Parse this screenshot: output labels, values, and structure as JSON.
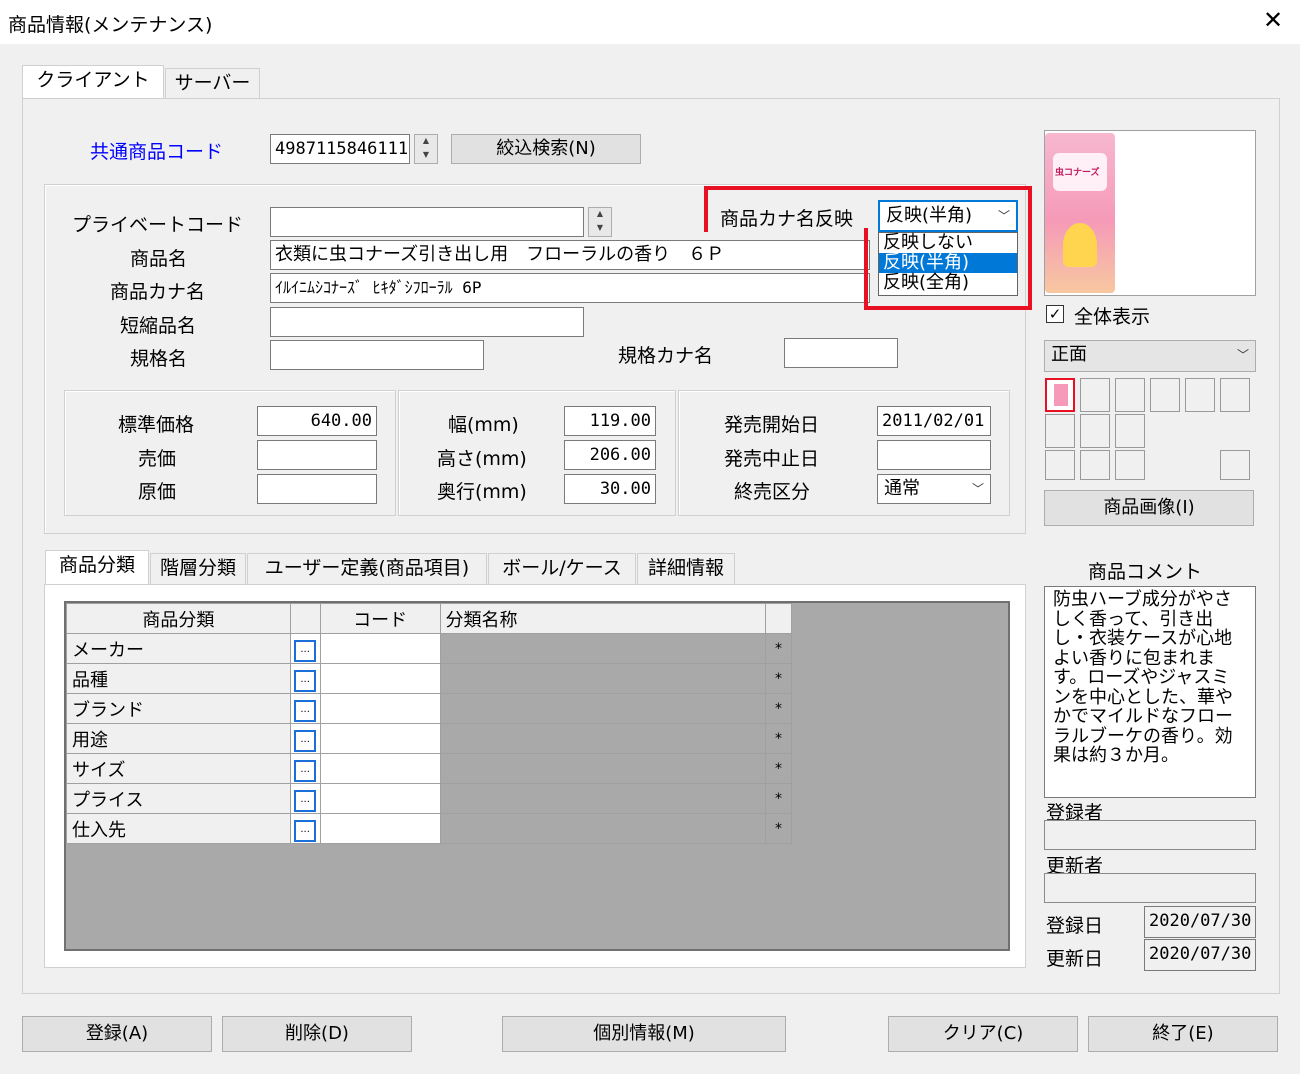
{
  "window": {
    "title": "商品情報(メンテナンス)",
    "close_glyph": "✕"
  },
  "tabs": [
    {
      "label": "クライアント"
    },
    {
      "label": "サーバー"
    }
  ],
  "common_code": {
    "label": "共通商品コード",
    "value": "4987115846111",
    "search_button": "絞込検索(N)"
  },
  "fields": {
    "private_code": {
      "label": "プライベートコード",
      "value": ""
    },
    "product_name": {
      "label": "商品名",
      "value": "衣類に虫コナーズ引き出し用　フローラルの香り　６Ｐ"
    },
    "product_kana": {
      "label": "商品カナ名",
      "value": "ｲﾙｲﾆﾑｼｺﾅｰｽﾞ ﾋｷﾀﾞｼﾌﾛｰﾗﾙ 6P"
    },
    "short_name": {
      "label": "短縮品名",
      "value": ""
    },
    "spec_name": {
      "label": "規格名",
      "value": ""
    },
    "spec_kana": {
      "label": "規格カナ名",
      "value": ""
    }
  },
  "kana_reflect": {
    "label": "商品カナ名反映",
    "selected": "反映(半角)",
    "options": [
      "反映しない",
      "反映(半角)",
      "反映(全角)"
    ],
    "highlighted_index": 1
  },
  "prices": {
    "standard": {
      "label": "標準価格",
      "value": "640.00"
    },
    "sale": {
      "label": "売価",
      "value": ""
    },
    "cost": {
      "label": "原価",
      "value": ""
    }
  },
  "dimensions": {
    "width": {
      "label": "幅(mm)",
      "value": "119.00"
    },
    "height": {
      "label": "高さ(mm)",
      "value": "206.00"
    },
    "depth": {
      "label": "奥行(mm)",
      "value": "30.00"
    }
  },
  "sales": {
    "start": {
      "label": "発売開始日",
      "value": "2011/02/01"
    },
    "stop": {
      "label": "発売中止日",
      "value": ""
    },
    "end_type": {
      "label": "終売区分",
      "value": "通常"
    }
  },
  "image": {
    "show_all_label": "全体表示",
    "show_all_checked": true,
    "view_select": "正面",
    "image_button": "商品画像(I)",
    "product_text": "虫コナーズ"
  },
  "sub_tabs": [
    {
      "label": "商品分類"
    },
    {
      "label": "階層分類"
    },
    {
      "label": "ユーザー定義(商品項目)"
    },
    {
      "label": "ボール/ケース"
    },
    {
      "label": "詳細情報"
    }
  ],
  "classification": {
    "headers": [
      "商品分類",
      "",
      "コード",
      "分類名称"
    ],
    "rows": [
      {
        "name": "メーカー",
        "dots": "...",
        "code": "",
        "title": "",
        "mark": "*"
      },
      {
        "name": "品種",
        "dots": "...",
        "code": "",
        "title": "",
        "mark": "*"
      },
      {
        "name": "ブランド",
        "dots": "...",
        "code": "",
        "title": "",
        "mark": "*"
      },
      {
        "name": "用途",
        "dots": "...",
        "code": "",
        "title": "",
        "mark": "*"
      },
      {
        "name": "サイズ",
        "dots": "...",
        "code": "",
        "title": "",
        "mark": "*"
      },
      {
        "name": "プライス",
        "dots": "...",
        "code": "",
        "title": "",
        "mark": "*"
      },
      {
        "name": "仕入先",
        "dots": "...",
        "code": "",
        "title": "",
        "mark": "*"
      }
    ]
  },
  "comment": {
    "label": "商品コメント",
    "text": "防虫ハーブ成分がやさしく香って、引き出し・衣装ケースが心地よい香りに包まれます。ローズやジャスミンを中心とした、華やかでマイルドなフローラルブーケの香り。効果は約３か月。"
  },
  "audit": {
    "registrant_label": "登録者",
    "registrant": "",
    "updater_label": "更新者",
    "updater": "",
    "reg_date_label": "登録日",
    "reg_date": "2020/07/30",
    "upd_date_label": "更新日",
    "upd_date": "2020/07/30"
  },
  "footer": {
    "register": "登録(A)",
    "delete": "削除(D)",
    "individual": "個別情報(M)",
    "clear": "クリア(C)",
    "exit": "終了(E)"
  },
  "colors": {
    "highlight": "#e81123",
    "selection": "#0078d7",
    "link_label": "#0000ff"
  }
}
